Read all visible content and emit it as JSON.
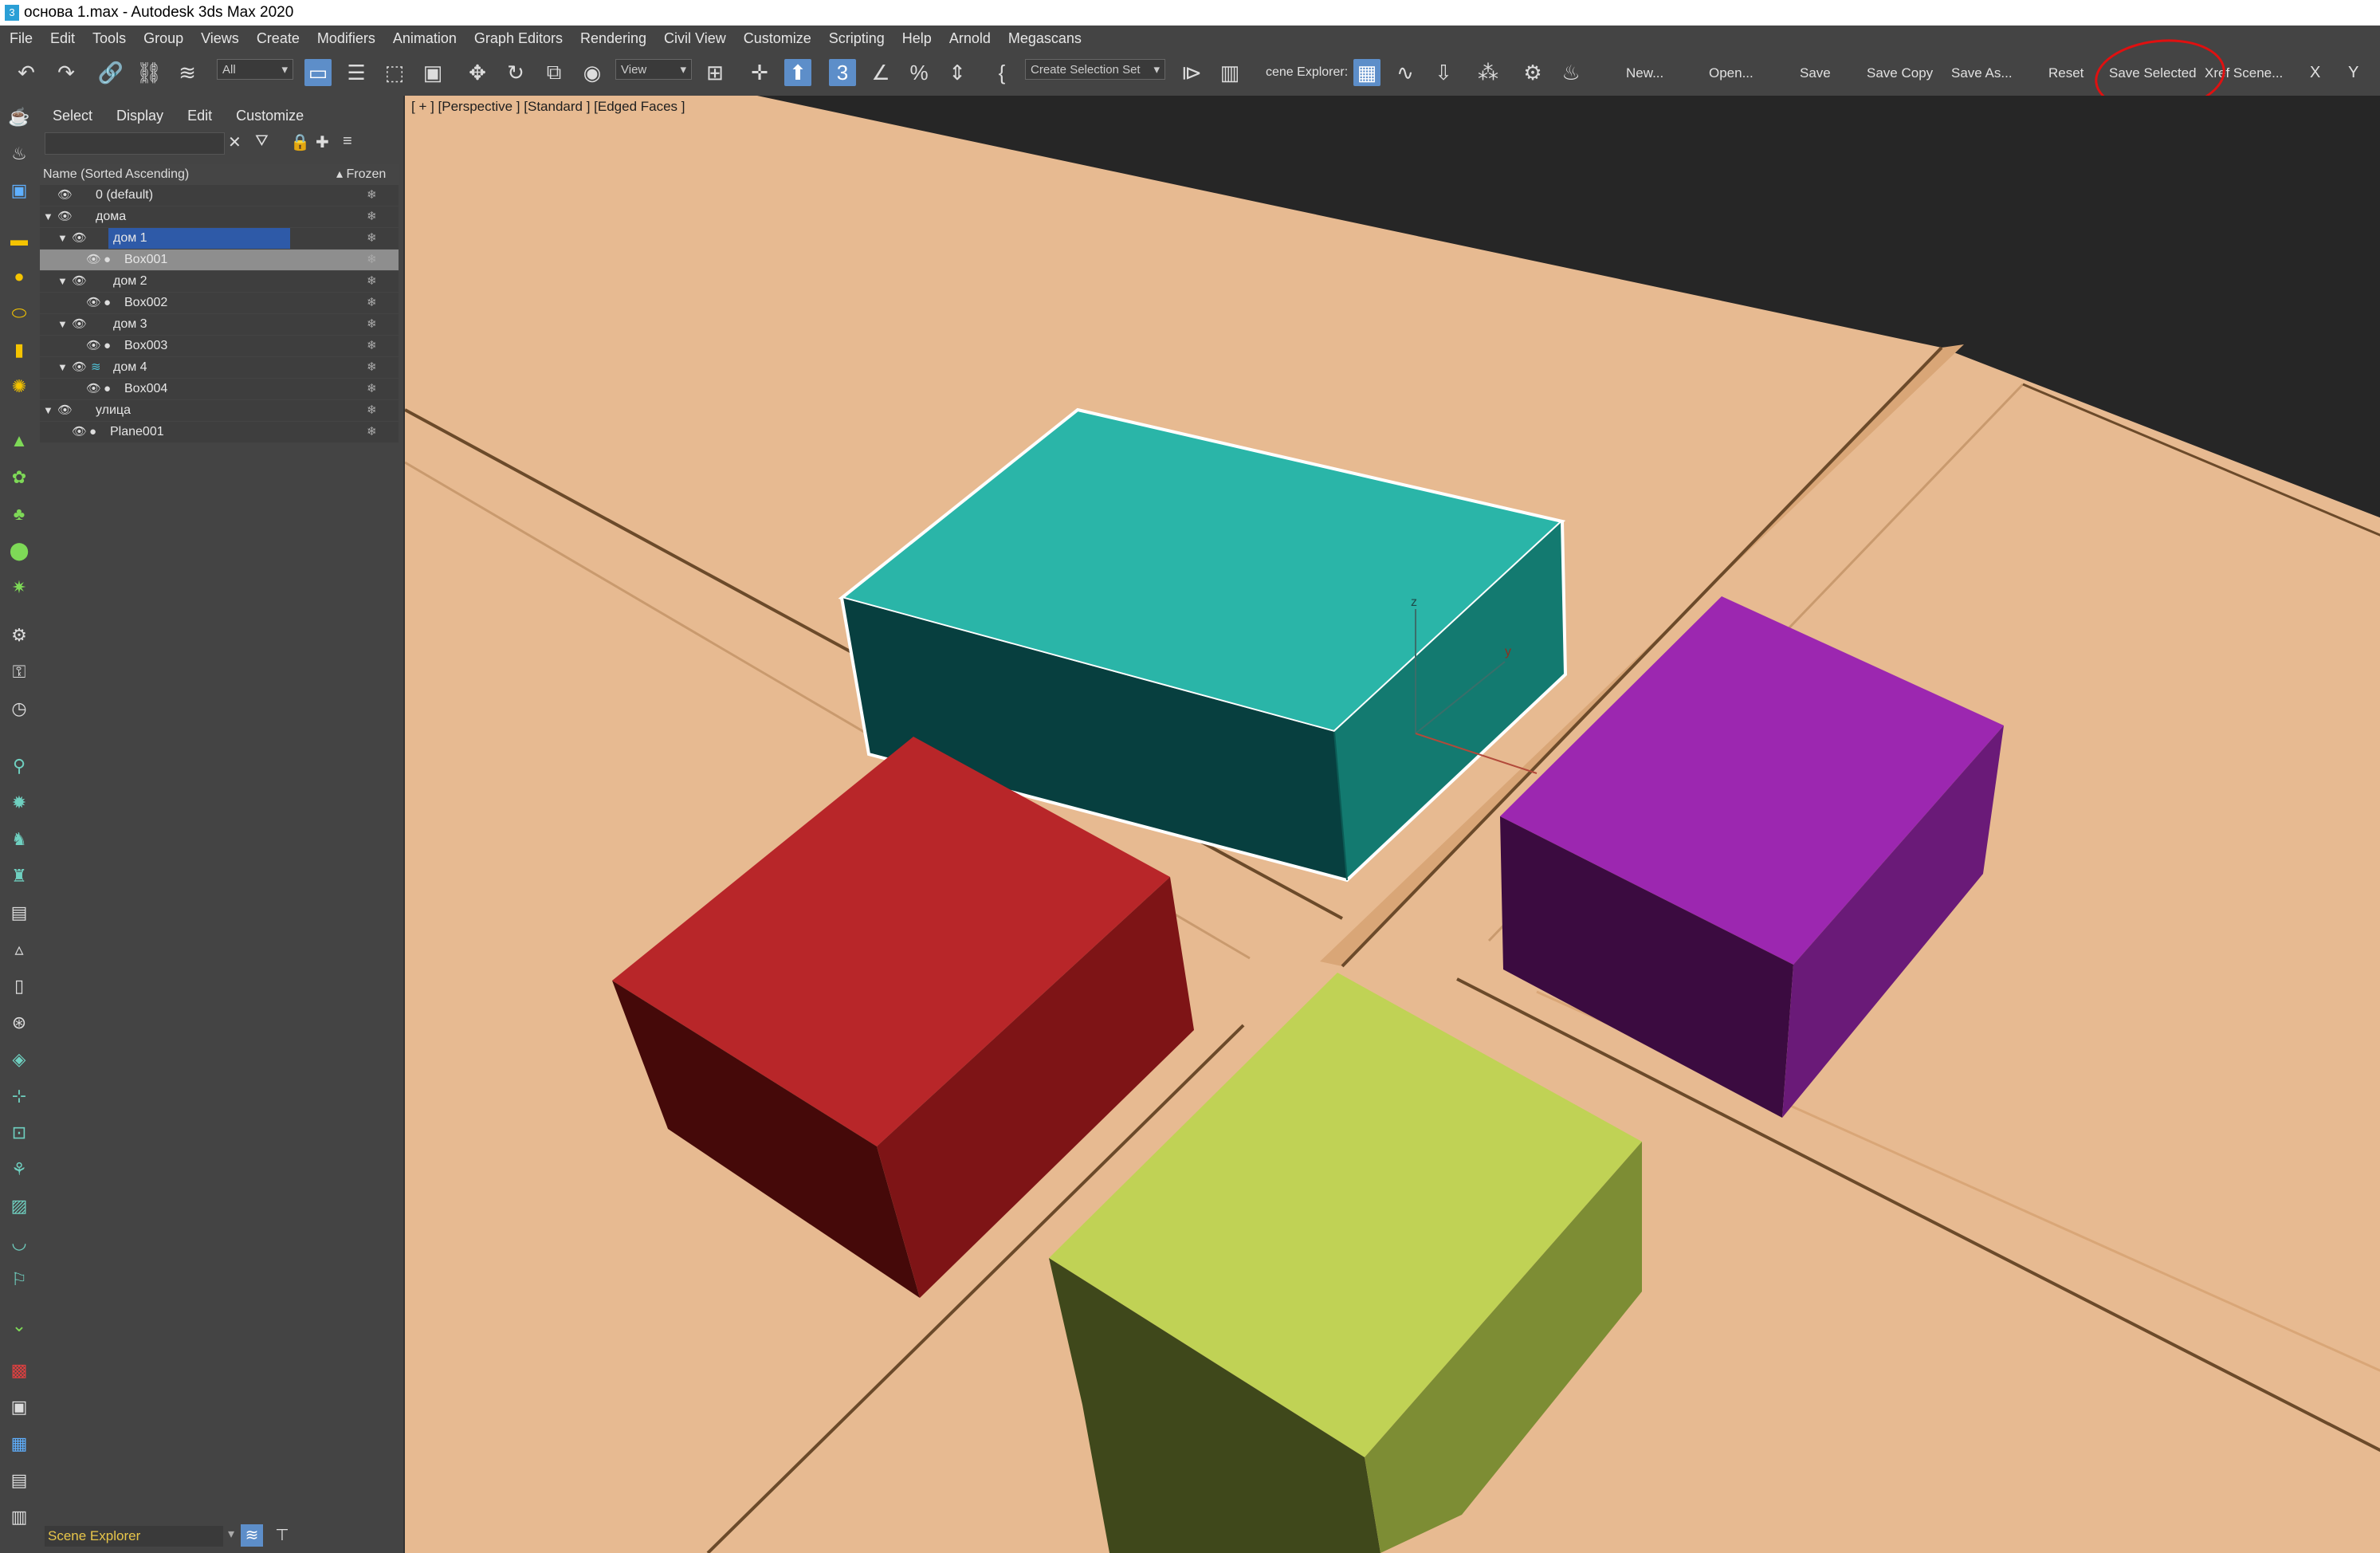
{
  "window": {
    "title": "основа 1.max - Autodesk 3ds Max 2020"
  },
  "menu": [
    "File",
    "Edit",
    "Tools",
    "Group",
    "Views",
    "Create",
    "Modifiers",
    "Animation",
    "Graph Editors",
    "Rendering",
    "Civil View",
    "Customize",
    "Scripting",
    "Help",
    "Arnold",
    "Megascans"
  ],
  "toolbar": {
    "filter_value": "All",
    "ref_coord_value": "View",
    "selection_set_value": "Create Selection Set",
    "scene_explorer_label": "cene Explorer:",
    "buttons": {
      "new": "New...",
      "open": "Open...",
      "save": "Save",
      "save_copy": "Save Copy",
      "save_as": "Save As...",
      "reset": "Reset",
      "save_selected": "Save Selected",
      "xref_scene": "Xref Scene...",
      "x": "X",
      "y": "Y"
    }
  },
  "explorer": {
    "menu": [
      "Select",
      "Display",
      "Edit",
      "Customize"
    ],
    "header_name": "Name (Sorted Ascending)",
    "header_frozen": "Frozen",
    "rows": [
      {
        "label": "0 (default)"
      },
      {
        "label": "дома"
      },
      {
        "label": "дом 1"
      },
      {
        "label": "Box001"
      },
      {
        "label": "дом 2"
      },
      {
        "label": "Box002"
      },
      {
        "label": "дом 3"
      },
      {
        "label": "Box003"
      },
      {
        "label": "дом 4"
      },
      {
        "label": "Box004"
      },
      {
        "label": "улица"
      },
      {
        "label": "Plane001"
      }
    ],
    "bottom_name": "Scene Explorer"
  },
  "viewport": {
    "label": "[ + ] [Perspective ]  [Standard ]  [Edged Faces ]",
    "colors": {
      "ground": "#e7ba91",
      "box_cyan": "#2ab5a8",
      "box_purple": "#9c27b0",
      "box_red": "#b82629",
      "box_lime": "#c0d255",
      "background": "#262626"
    }
  }
}
